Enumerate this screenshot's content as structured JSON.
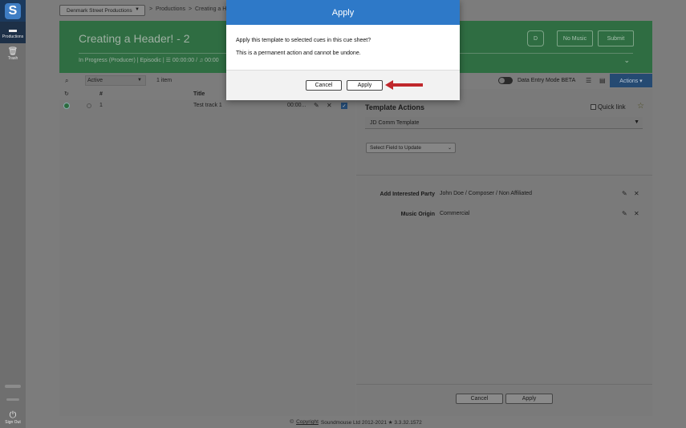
{
  "nav": {
    "logo": "S",
    "productions_label": "Productions",
    "trash_label": "Trash",
    "signout_label": "Sign Out"
  },
  "topbar": {
    "production_select": "Denmark Street Productions",
    "crumb_sep": ">",
    "crumb_productions": "Productions",
    "crumb_current": "Creating a H"
  },
  "header": {
    "title": "Creating a Header! - 2",
    "meta": "In Progress (Producer) | Episodic | ☰ 00:00:00 / ♫ 00:00",
    "d_button": "D",
    "no_music_button": "No Music",
    "submit_button": "Submit"
  },
  "toolbar": {
    "status_value": "Active",
    "item_count": "1 item",
    "data_entry_mode_label": "Data Entry Mode BETA",
    "actions_button": "Actions ▾"
  },
  "table": {
    "col_number": "#",
    "col_title": "Title",
    "rows": [
      {
        "number": "1",
        "title": "Test track 1",
        "duration": "00:00..."
      }
    ]
  },
  "right_pane": {
    "title": "Template Actions",
    "quick_link_label": "Quick link",
    "template_value": "JD Comm Template",
    "field_select_value": "Select Field to Update",
    "properties": [
      {
        "label": "Add Interested Party",
        "value": "John Doe / Composer / Non Affiliated"
      },
      {
        "label": "Music Origin",
        "value": "Commercial"
      }
    ],
    "cancel_button": "Cancel",
    "apply_button": "Apply"
  },
  "footer": {
    "prefix": "©",
    "copyright_link": "Copyright",
    "text": "Soundmouse Ltd 2012-2021 ★ 3.3.32.1572"
  },
  "modal": {
    "title": "Apply",
    "line1": "Apply this template to selected cues in this cue sheet?",
    "line2": "This is a permanent action and cannot be undone.",
    "cancel_button": "Cancel",
    "apply_button": "Apply"
  },
  "colors": {
    "header_green": "#2f6d42",
    "modal_blue": "#2e79c8",
    "arrow_red": "#c0282d",
    "nav_dark": "#1d3047"
  }
}
